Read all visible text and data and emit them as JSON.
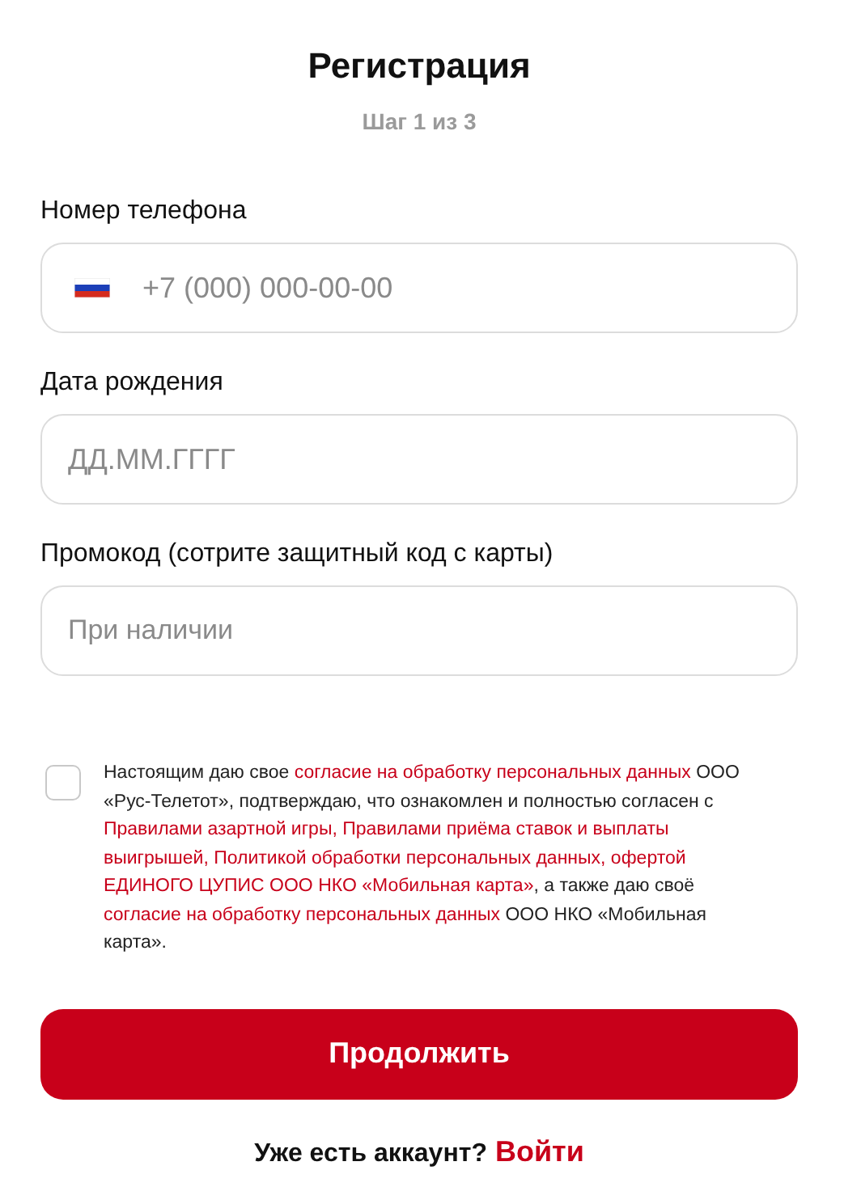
{
  "title": "Регистрация",
  "step": "Шаг 1 из 3",
  "fields": [
    {
      "kind": "phone",
      "label": "Номер телефона",
      "placeholder": "+7 (000) 000-00-00"
    },
    {
      "kind": "text",
      "label": "Дата рождения",
      "placeholder": "ДД.ММ.ГГГГ"
    },
    {
      "kind": "text",
      "label": "Промокод (сотрите защитный код с карты)",
      "placeholder": "При наличии"
    }
  ],
  "consent": {
    "checked": false,
    "lines": [
      [
        {
          "kind": "text",
          "text": "Настоящим даю свое "
        },
        {
          "kind": "link",
          "text": "согласие на обработку персональных данных"
        },
        {
          "kind": "text",
          "text": " ООО"
        }
      ],
      [
        {
          "kind": "text",
          "text": "«Рус-Телетот», подтверждаю, что ознакомлен и полностью согласен с"
        }
      ],
      [
        {
          "kind": "link",
          "text": "Правилами азартной игры, Правилами приёма ставок и выплаты"
        }
      ],
      [
        {
          "kind": "link",
          "text": "выигрышей, Политикой обработки персональных данных, офертой"
        }
      ],
      [
        {
          "kind": "link",
          "text": "ЕДИНОГО ЦУПИС ООО НКО «Мобильная карта»"
        },
        {
          "kind": "text",
          "text": ", а также даю своё"
        }
      ],
      [
        {
          "kind": "link",
          "text": "согласие на обработку персональных данных"
        },
        {
          "kind": "text",
          "text": " ООО НКО «Мобильная"
        }
      ],
      [
        {
          "kind": "text",
          "text": "карта»."
        }
      ]
    ]
  },
  "submit": "Продолжить",
  "login": {
    "question": "Уже есть аккаунт?",
    "link": "Войти"
  }
}
